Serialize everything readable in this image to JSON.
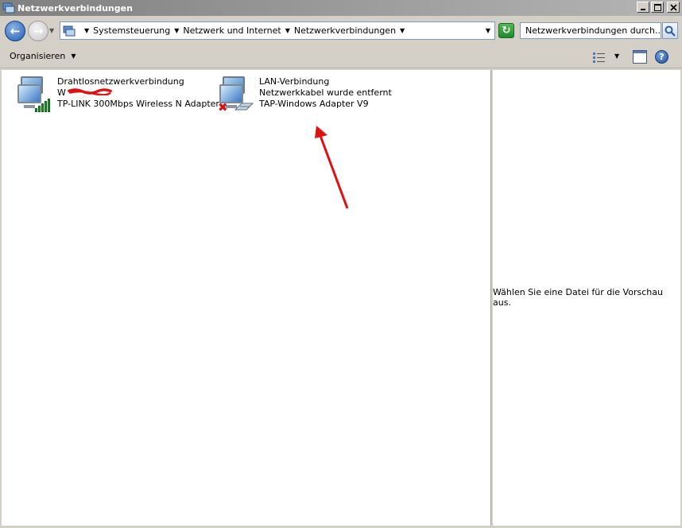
{
  "window": {
    "title": "Netzwerkverbindungen"
  },
  "address": {
    "crumbs": [
      "Systemsteuerung",
      "Netzwerk und Internet",
      "Netzwerkverbindungen"
    ],
    "search_placeholder": "Netzwerkverbindungen durch..."
  },
  "toolbar": {
    "organize_label": "Organisieren"
  },
  "connections": [
    {
      "name": "Drahtlosnetzwerkverbindung",
      "status": "W",
      "adapter": "TP-LINK 300Mbps Wireless N Adapter"
    },
    {
      "name": "LAN-Verbindung",
      "status": "Netzwerkkabel wurde entfernt",
      "adapter": "TAP-Windows Adapter V9"
    }
  ],
  "preview": {
    "text": "Wählen Sie eine Datei für die Vorschau aus."
  },
  "colors": {
    "accent_blue": "#1f5bb0",
    "error_red": "#d21414",
    "signal_green": "#1e9d2c",
    "annotation_red": "#e01010"
  }
}
